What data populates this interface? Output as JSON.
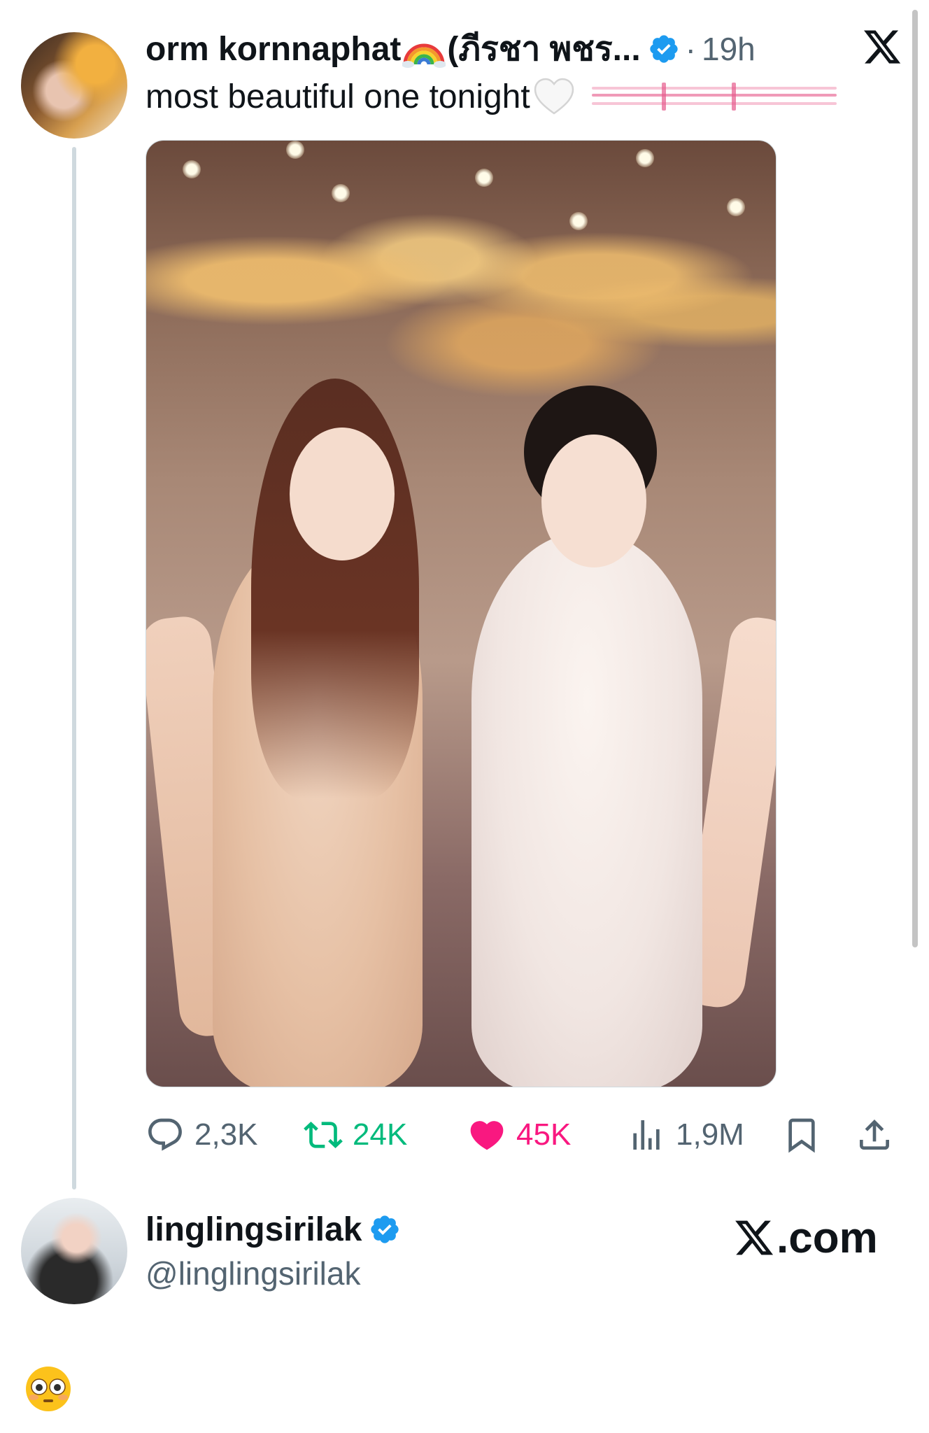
{
  "tweet": {
    "display_name": "orm kornnaphat",
    "name_suffix": "(ภีรชา พชร...",
    "separator": "·",
    "time": "19h",
    "text": "most beautiful one tonight",
    "platform_icon": "x-logo-icon",
    "emojis": [
      "rainbow-emoji",
      "white-heart-emoji"
    ]
  },
  "actions": {
    "reply_count": "2,3K",
    "retweet_count": "24K",
    "like_count": "45K",
    "views_count": "1,9M"
  },
  "colors": {
    "verified": "#1d9bf0",
    "retweet": "#00ba7c",
    "like": "#f91880",
    "secondary_text": "#536471"
  },
  "profile_card": {
    "display_name": "linglingsirilak",
    "handle": "@linglingsirilak",
    "site_label": ".com"
  },
  "footer": {
    "reaction_emoji": "flushed-face-emoji"
  }
}
